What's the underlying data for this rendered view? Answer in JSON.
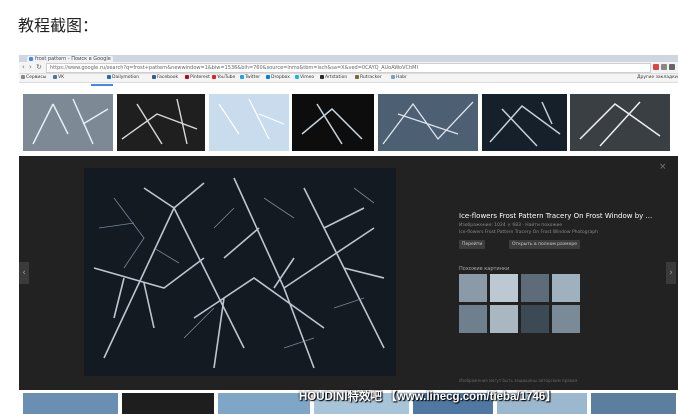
{
  "caption": "教程截图：",
  "browser": {
    "tab_title": "frost pattern - Поиск в Google",
    "url": "https://www.google.ru/search?q=frost+pattern&newwindow=1&biw=1536&bih=760&source=lnms&tbm=isch&sa=X&ved=0CAYQ_AUoAWoVChMI",
    "bookmarks": [
      "Сервисы",
      "VK",
      "Dailymotion",
      "Facebook",
      "Pinterest",
      "YouTube",
      "Twitter",
      "Dropbox",
      "Vimeo",
      "Artstation",
      "Rutracker",
      "Habr"
    ],
    "bookmark_colors": [
      "#888888",
      "#4a76a8",
      "#1a6dc4",
      "#3b5998",
      "#bd081c",
      "#e62117",
      "#1da1f2",
      "#007ee5",
      "#1ab7ea",
      "#2a2a2a",
      "#7a6a3a",
      "#77a2c7"
    ],
    "right_bookmark": "Другие закладки"
  },
  "viewer": {
    "title": "Ice-flowers Frost Pattern Tracery On Frost Window by ...",
    "size_info": "Изображение: 1024 × 683 · Найти похожие",
    "source_line": "Ice-flowers Frost Pattern Tracery On Frost Window Photograph",
    "buttons": [
      "Перейти",
      "Открыть в полном размере"
    ],
    "related_label": "Похожие картинки",
    "footer": "Изображения могут быть защищены авторским правом",
    "close_label": "×",
    "prev_label": "‹",
    "next_label": "›"
  },
  "watermark": "HOUDINI特效吧 【www.linecg.com/tieba/1746】"
}
